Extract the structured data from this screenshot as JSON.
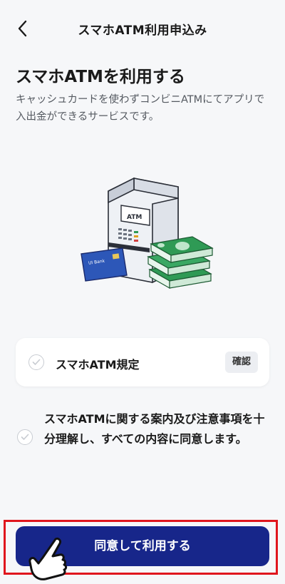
{
  "header": {
    "title": "スマホATM利用申込み"
  },
  "page": {
    "title": "スマホATMを利用する",
    "description": "キャッシュカードを使わずコンビニATMにてアプリで入出金ができるサービスです。"
  },
  "illustration": {
    "atm_label": "ATM",
    "card_brand": "UI Bank"
  },
  "terms_card": {
    "label": "スマホATM規定",
    "confirm_label": "確認"
  },
  "agreement": {
    "text": "スマホATMに関する案内及び注意事項を十分理解し、すべての内容に同意します。"
  },
  "primary_button": {
    "label": "同意して利用する"
  },
  "colors": {
    "background": "#f6f7f9",
    "primary": "#17268a",
    "highlight": "#e0161d",
    "money": "#2f9a55"
  },
  "icons": {
    "back": "chevron-left-icon",
    "check": "check-circle-icon",
    "pointer": "pointing-hand-icon"
  }
}
